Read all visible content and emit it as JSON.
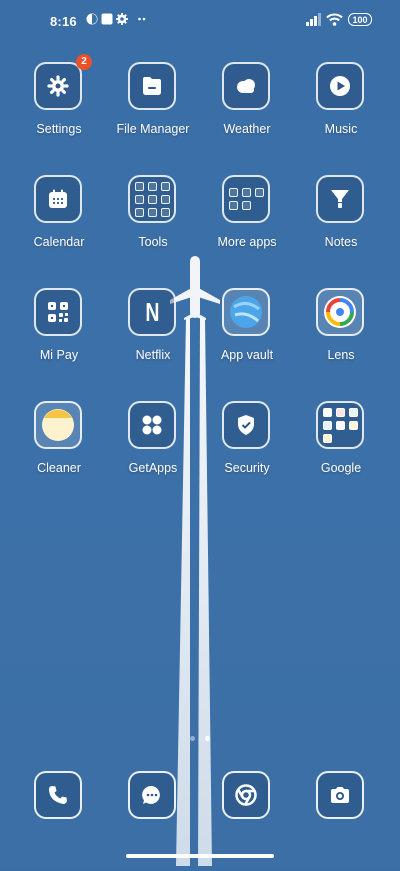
{
  "status": {
    "time": "8:16",
    "battery": "100"
  },
  "apps": {
    "settings": {
      "label": "Settings",
      "badge": "2"
    },
    "file_manager": {
      "label": "File Manager"
    },
    "weather": {
      "label": "Weather"
    },
    "music": {
      "label": "Music"
    },
    "calendar": {
      "label": "Calendar"
    },
    "tools": {
      "label": "Tools"
    },
    "more_apps": {
      "label": "More apps"
    },
    "notes": {
      "label": "Notes"
    },
    "mi_pay": {
      "label": "Mi Pay"
    },
    "netflix": {
      "label": "Netflix",
      "glyph": "N"
    },
    "app_vault": {
      "label": "App vault"
    },
    "lens": {
      "label": "Lens"
    },
    "cleaner": {
      "label": "Cleaner"
    },
    "getapps": {
      "label": "GetApps"
    },
    "security": {
      "label": "Security"
    },
    "google": {
      "label": "Google"
    }
  },
  "dock": [
    "phone-icon",
    "messages-icon",
    "chrome-icon",
    "camera-icon"
  ],
  "page_indicator": {
    "pages": 2,
    "current": 2
  },
  "colors": {
    "wallpaper": "#3b6fa6",
    "badge": "#e8512a",
    "tile_border": "#ffffff"
  }
}
